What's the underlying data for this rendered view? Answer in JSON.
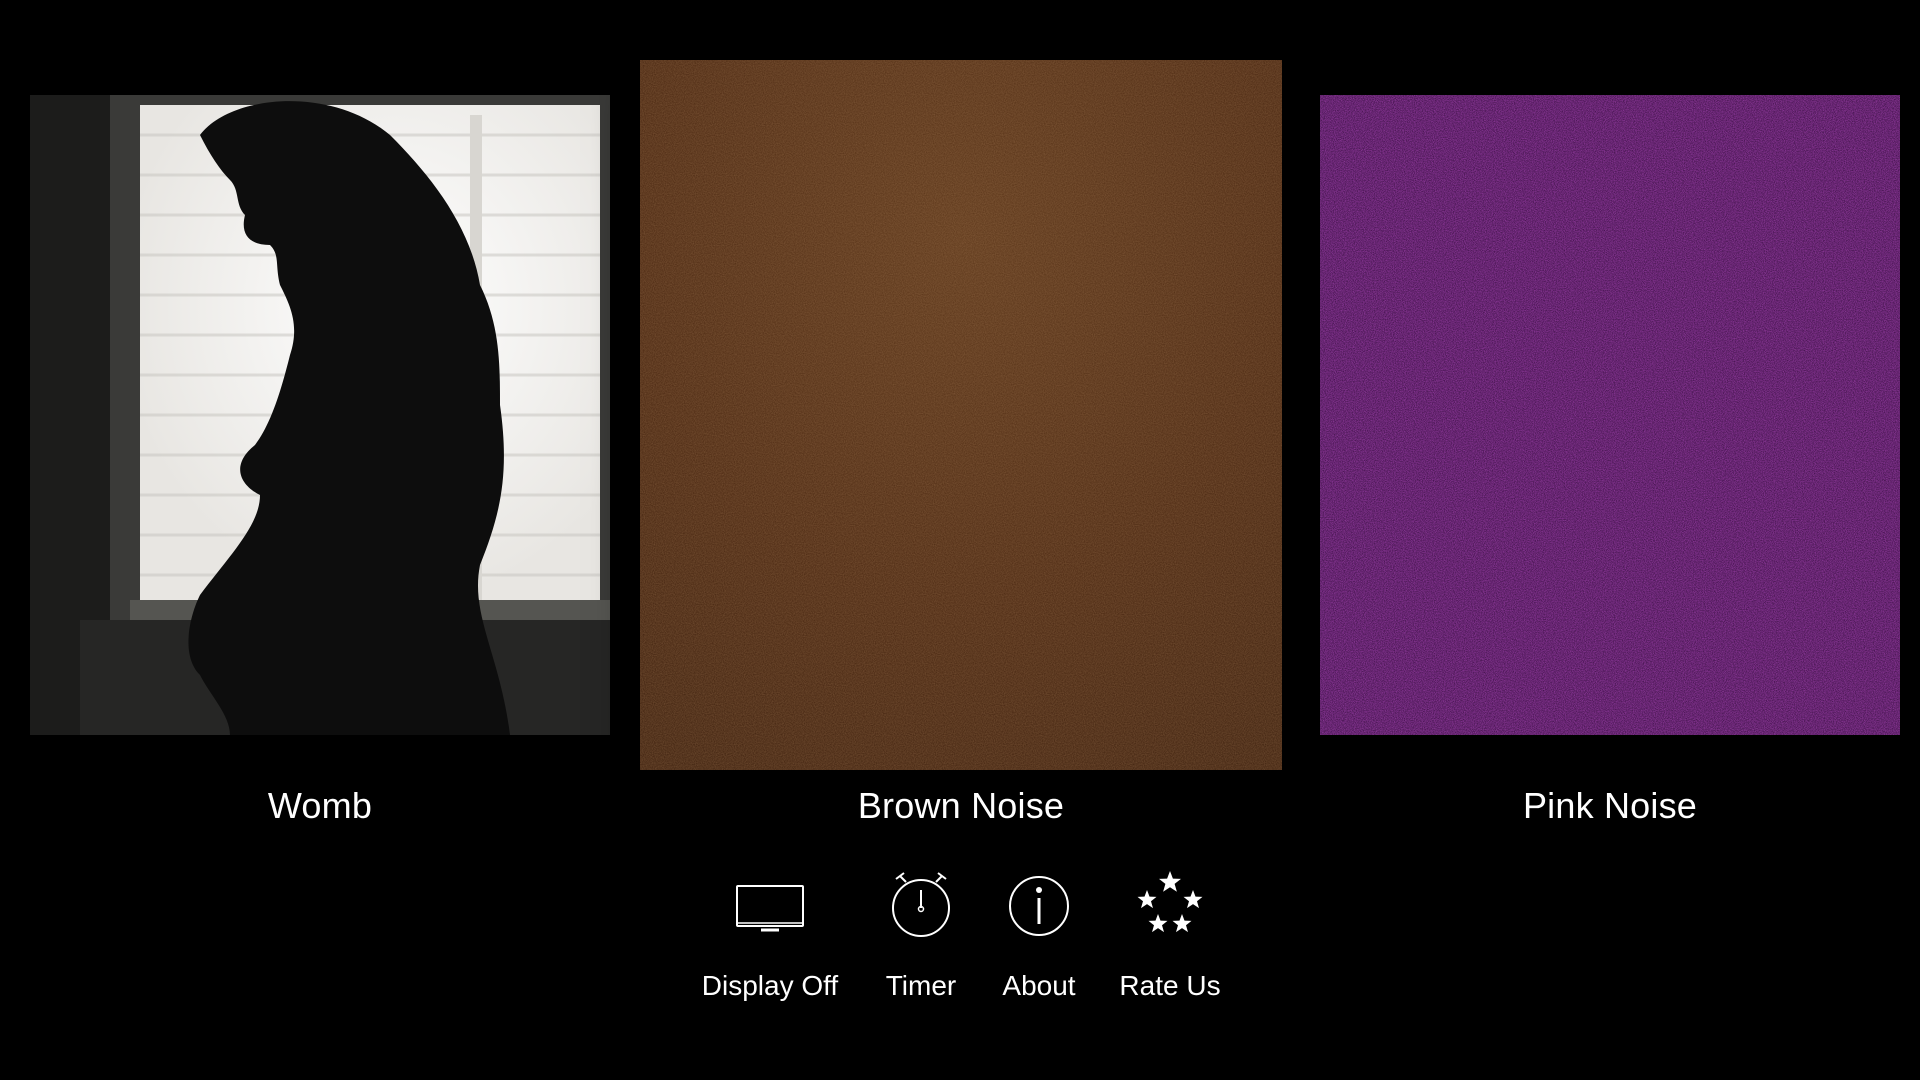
{
  "tiles": [
    {
      "id": "womb",
      "label": "Womb"
    },
    {
      "id": "brown-noise",
      "label": "Brown Noise",
      "color": "#4a2a12"
    },
    {
      "id": "pink-noise",
      "label": "Pink Noise",
      "color": "#4a0d55"
    }
  ],
  "toolbar": [
    {
      "id": "display-off",
      "label": "Display Off",
      "icon": "tv-icon"
    },
    {
      "id": "timer",
      "label": "Timer",
      "icon": "stopwatch-icon"
    },
    {
      "id": "about",
      "label": "About",
      "icon": "info-icon"
    },
    {
      "id": "rate-us",
      "label": "Rate Us",
      "icon": "stars-icon"
    }
  ],
  "theme": {
    "background": "#000000",
    "text": "#ffffff"
  }
}
